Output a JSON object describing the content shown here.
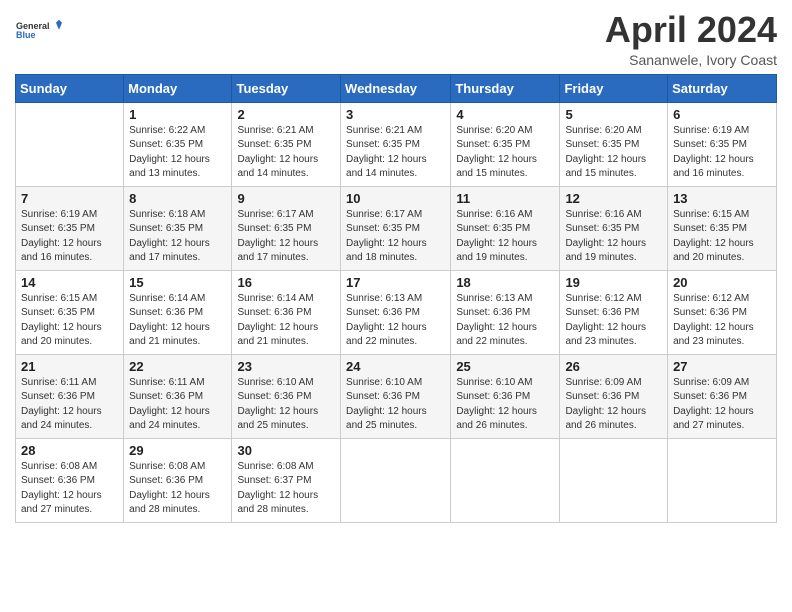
{
  "logo": {
    "line1": "General",
    "line2": "Blue"
  },
  "title": "April 2024",
  "subtitle": "Sananwele, Ivory Coast",
  "days_header": [
    "Sunday",
    "Monday",
    "Tuesday",
    "Wednesday",
    "Thursday",
    "Friday",
    "Saturday"
  ],
  "weeks": [
    [
      {
        "day": "",
        "info": ""
      },
      {
        "day": "1",
        "info": "Sunrise: 6:22 AM\nSunset: 6:35 PM\nDaylight: 12 hours\nand 13 minutes."
      },
      {
        "day": "2",
        "info": "Sunrise: 6:21 AM\nSunset: 6:35 PM\nDaylight: 12 hours\nand 14 minutes."
      },
      {
        "day": "3",
        "info": "Sunrise: 6:21 AM\nSunset: 6:35 PM\nDaylight: 12 hours\nand 14 minutes."
      },
      {
        "day": "4",
        "info": "Sunrise: 6:20 AM\nSunset: 6:35 PM\nDaylight: 12 hours\nand 15 minutes."
      },
      {
        "day": "5",
        "info": "Sunrise: 6:20 AM\nSunset: 6:35 PM\nDaylight: 12 hours\nand 15 minutes."
      },
      {
        "day": "6",
        "info": "Sunrise: 6:19 AM\nSunset: 6:35 PM\nDaylight: 12 hours\nand 16 minutes."
      }
    ],
    [
      {
        "day": "7",
        "info": "Sunrise: 6:19 AM\nSunset: 6:35 PM\nDaylight: 12 hours\nand 16 minutes."
      },
      {
        "day": "8",
        "info": "Sunrise: 6:18 AM\nSunset: 6:35 PM\nDaylight: 12 hours\nand 17 minutes."
      },
      {
        "day": "9",
        "info": "Sunrise: 6:17 AM\nSunset: 6:35 PM\nDaylight: 12 hours\nand 17 minutes."
      },
      {
        "day": "10",
        "info": "Sunrise: 6:17 AM\nSunset: 6:35 PM\nDaylight: 12 hours\nand 18 minutes."
      },
      {
        "day": "11",
        "info": "Sunrise: 6:16 AM\nSunset: 6:35 PM\nDaylight: 12 hours\nand 19 minutes."
      },
      {
        "day": "12",
        "info": "Sunrise: 6:16 AM\nSunset: 6:35 PM\nDaylight: 12 hours\nand 19 minutes."
      },
      {
        "day": "13",
        "info": "Sunrise: 6:15 AM\nSunset: 6:35 PM\nDaylight: 12 hours\nand 20 minutes."
      }
    ],
    [
      {
        "day": "14",
        "info": "Sunrise: 6:15 AM\nSunset: 6:35 PM\nDaylight: 12 hours\nand 20 minutes."
      },
      {
        "day": "15",
        "info": "Sunrise: 6:14 AM\nSunset: 6:36 PM\nDaylight: 12 hours\nand 21 minutes."
      },
      {
        "day": "16",
        "info": "Sunrise: 6:14 AM\nSunset: 6:36 PM\nDaylight: 12 hours\nand 21 minutes."
      },
      {
        "day": "17",
        "info": "Sunrise: 6:13 AM\nSunset: 6:36 PM\nDaylight: 12 hours\nand 22 minutes."
      },
      {
        "day": "18",
        "info": "Sunrise: 6:13 AM\nSunset: 6:36 PM\nDaylight: 12 hours\nand 22 minutes."
      },
      {
        "day": "19",
        "info": "Sunrise: 6:12 AM\nSunset: 6:36 PM\nDaylight: 12 hours\nand 23 minutes."
      },
      {
        "day": "20",
        "info": "Sunrise: 6:12 AM\nSunset: 6:36 PM\nDaylight: 12 hours\nand 23 minutes."
      }
    ],
    [
      {
        "day": "21",
        "info": "Sunrise: 6:11 AM\nSunset: 6:36 PM\nDaylight: 12 hours\nand 24 minutes."
      },
      {
        "day": "22",
        "info": "Sunrise: 6:11 AM\nSunset: 6:36 PM\nDaylight: 12 hours\nand 24 minutes."
      },
      {
        "day": "23",
        "info": "Sunrise: 6:10 AM\nSunset: 6:36 PM\nDaylight: 12 hours\nand 25 minutes."
      },
      {
        "day": "24",
        "info": "Sunrise: 6:10 AM\nSunset: 6:36 PM\nDaylight: 12 hours\nand 25 minutes."
      },
      {
        "day": "25",
        "info": "Sunrise: 6:10 AM\nSunset: 6:36 PM\nDaylight: 12 hours\nand 26 minutes."
      },
      {
        "day": "26",
        "info": "Sunrise: 6:09 AM\nSunset: 6:36 PM\nDaylight: 12 hours\nand 26 minutes."
      },
      {
        "day": "27",
        "info": "Sunrise: 6:09 AM\nSunset: 6:36 PM\nDaylight: 12 hours\nand 27 minutes."
      }
    ],
    [
      {
        "day": "28",
        "info": "Sunrise: 6:08 AM\nSunset: 6:36 PM\nDaylight: 12 hours\nand 27 minutes."
      },
      {
        "day": "29",
        "info": "Sunrise: 6:08 AM\nSunset: 6:36 PM\nDaylight: 12 hours\nand 28 minutes."
      },
      {
        "day": "30",
        "info": "Sunrise: 6:08 AM\nSunset: 6:37 PM\nDaylight: 12 hours\nand 28 minutes."
      },
      {
        "day": "",
        "info": ""
      },
      {
        "day": "",
        "info": ""
      },
      {
        "day": "",
        "info": ""
      },
      {
        "day": "",
        "info": ""
      }
    ]
  ]
}
